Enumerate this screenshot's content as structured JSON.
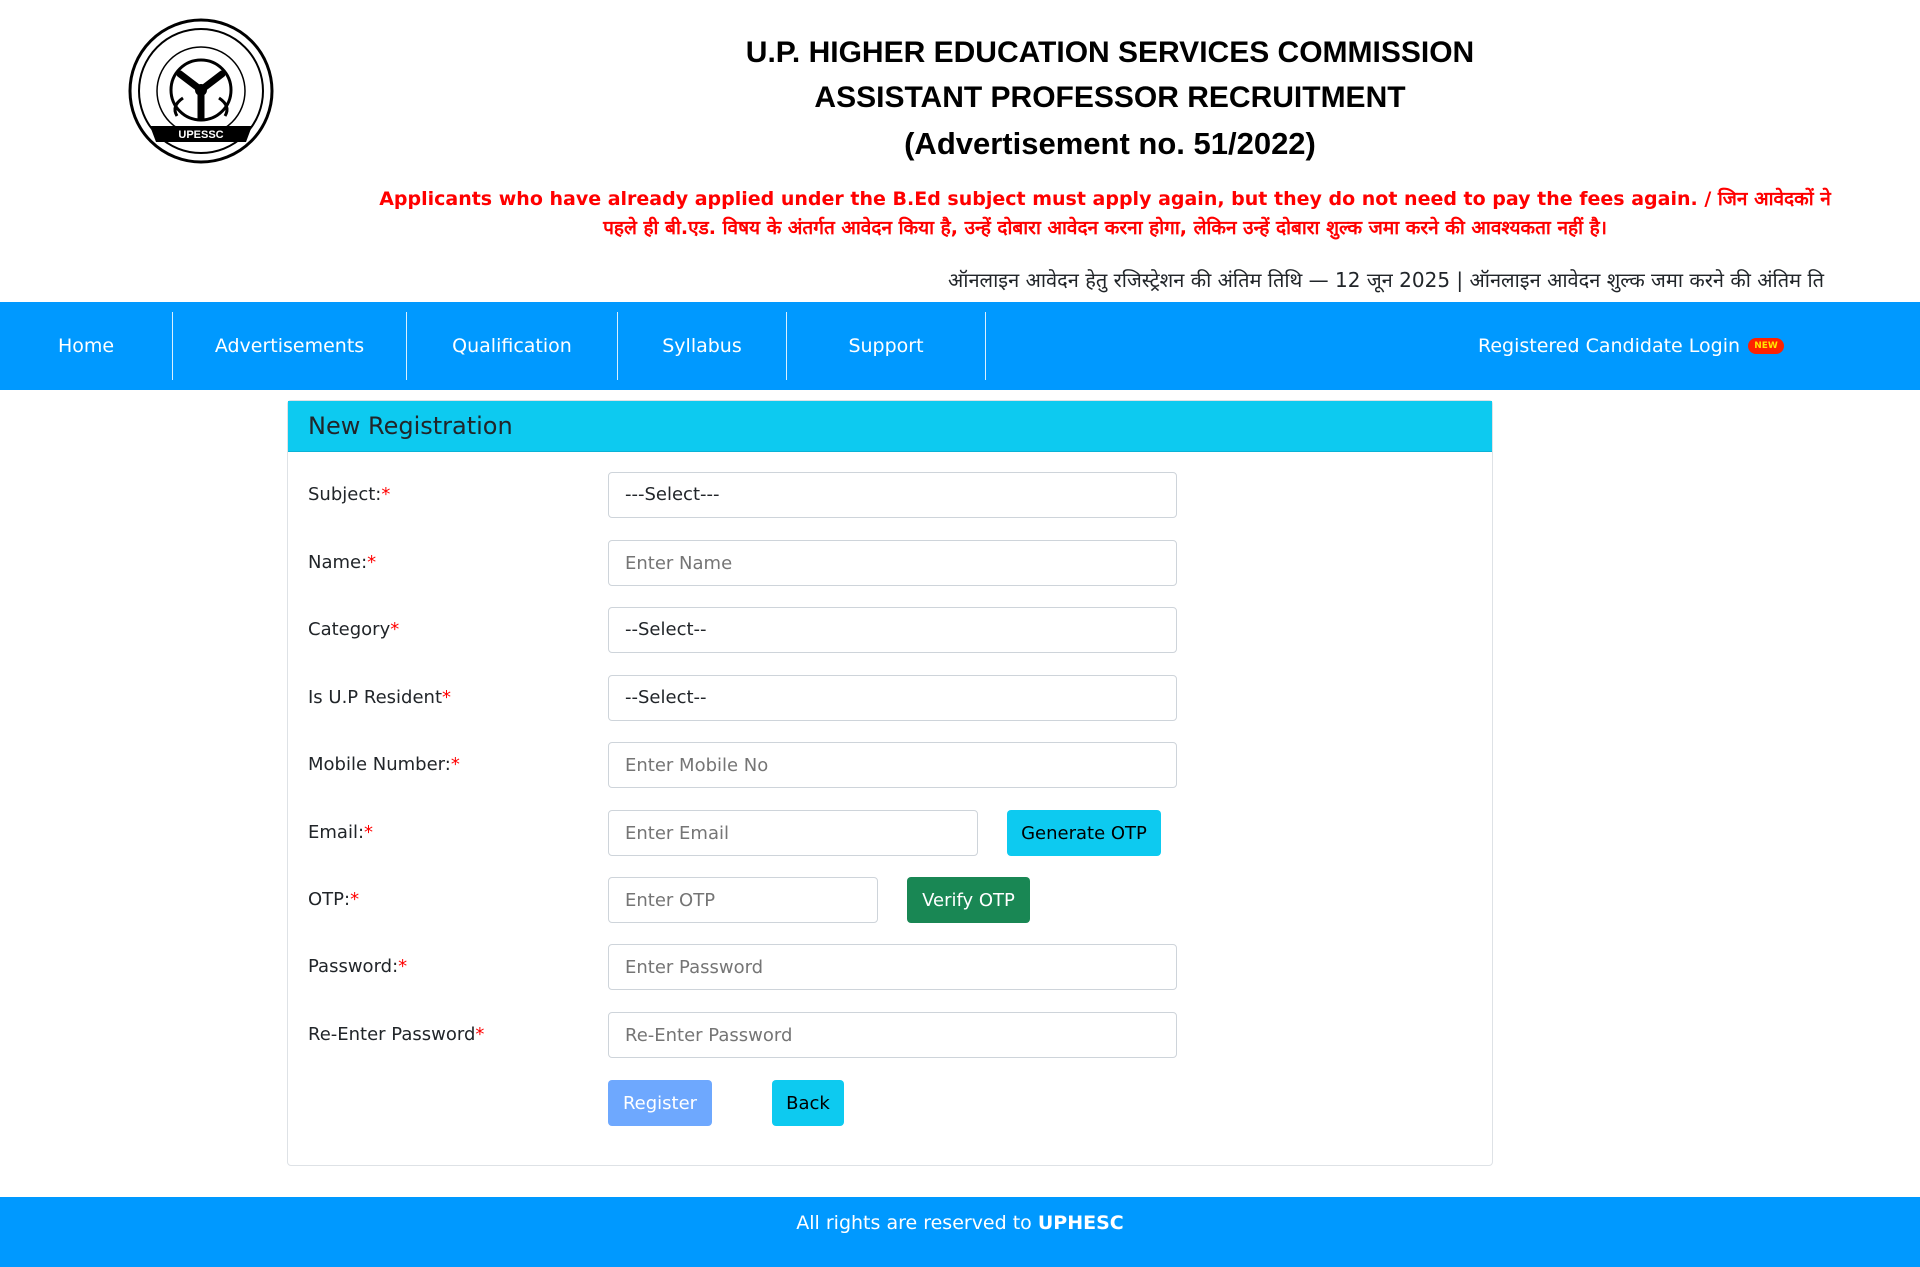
{
  "header": {
    "logo_text": "UPESSC",
    "title_line1": "U.P. HIGHER EDUCATION SERVICES COMMISSION",
    "title_line2": "ASSISTANT PROFESSOR RECRUITMENT",
    "title_line3": "(Advertisement no. 51/2022)",
    "notice": "Applicants who have already applied under the B.Ed subject must apply again, but they do not need to pay the fees again. / जिन आवेदकों ने पहले ही बी.एड. विषय के अंतर्गत आवेदन किया है, उन्हें दोबारा आवेदन करना होगा, लेकिन उन्हें दोबारा शुल्क जमा करने की आवश्यकता नहीं है।",
    "marquee": "ऑनलाइन आवेदन हेतु रजिस्ट्रेशन की अंतिम तिथि — 12 जून 2025 | ऑनलाइन आवेदन शुल्क जमा करने की अंतिम ति",
    "accent_color": "#ff0000"
  },
  "navbar": {
    "items": [
      {
        "label": "Home"
      },
      {
        "label": "Advertisements"
      },
      {
        "label": "Qualification"
      },
      {
        "label": "Syllabus"
      },
      {
        "label": "Support"
      }
    ],
    "login_label": "Registered Candidate Login",
    "new_badge": "NEW",
    "color": "#0099ff"
  },
  "form": {
    "title": "New Registration",
    "subject": {
      "label": "Subject:",
      "value": "---Select---"
    },
    "name": {
      "label": "Name:",
      "placeholder": "Enter Name"
    },
    "category": {
      "label": "Category",
      "value": "--Select--"
    },
    "resident": {
      "label": "Is U.P Resident",
      "value": "--Select--"
    },
    "mobile": {
      "label": "Mobile Number:",
      "placeholder": "Enter Mobile No"
    },
    "email": {
      "label": "Email:",
      "placeholder": "Enter Email",
      "button": "Generate OTP"
    },
    "otp": {
      "label": "OTP:",
      "placeholder": "Enter OTP",
      "button": "Verify OTP"
    },
    "password": {
      "label": "Password:",
      "placeholder": "Enter Password"
    },
    "repassword": {
      "label": "Re-Enter Password",
      "placeholder": "Re-Enter Password"
    },
    "required_mark": "*",
    "register_label": "Register",
    "back_label": "Back"
  },
  "footer": {
    "text": "All rights are reserved to ",
    "brand": "UPHESC"
  }
}
